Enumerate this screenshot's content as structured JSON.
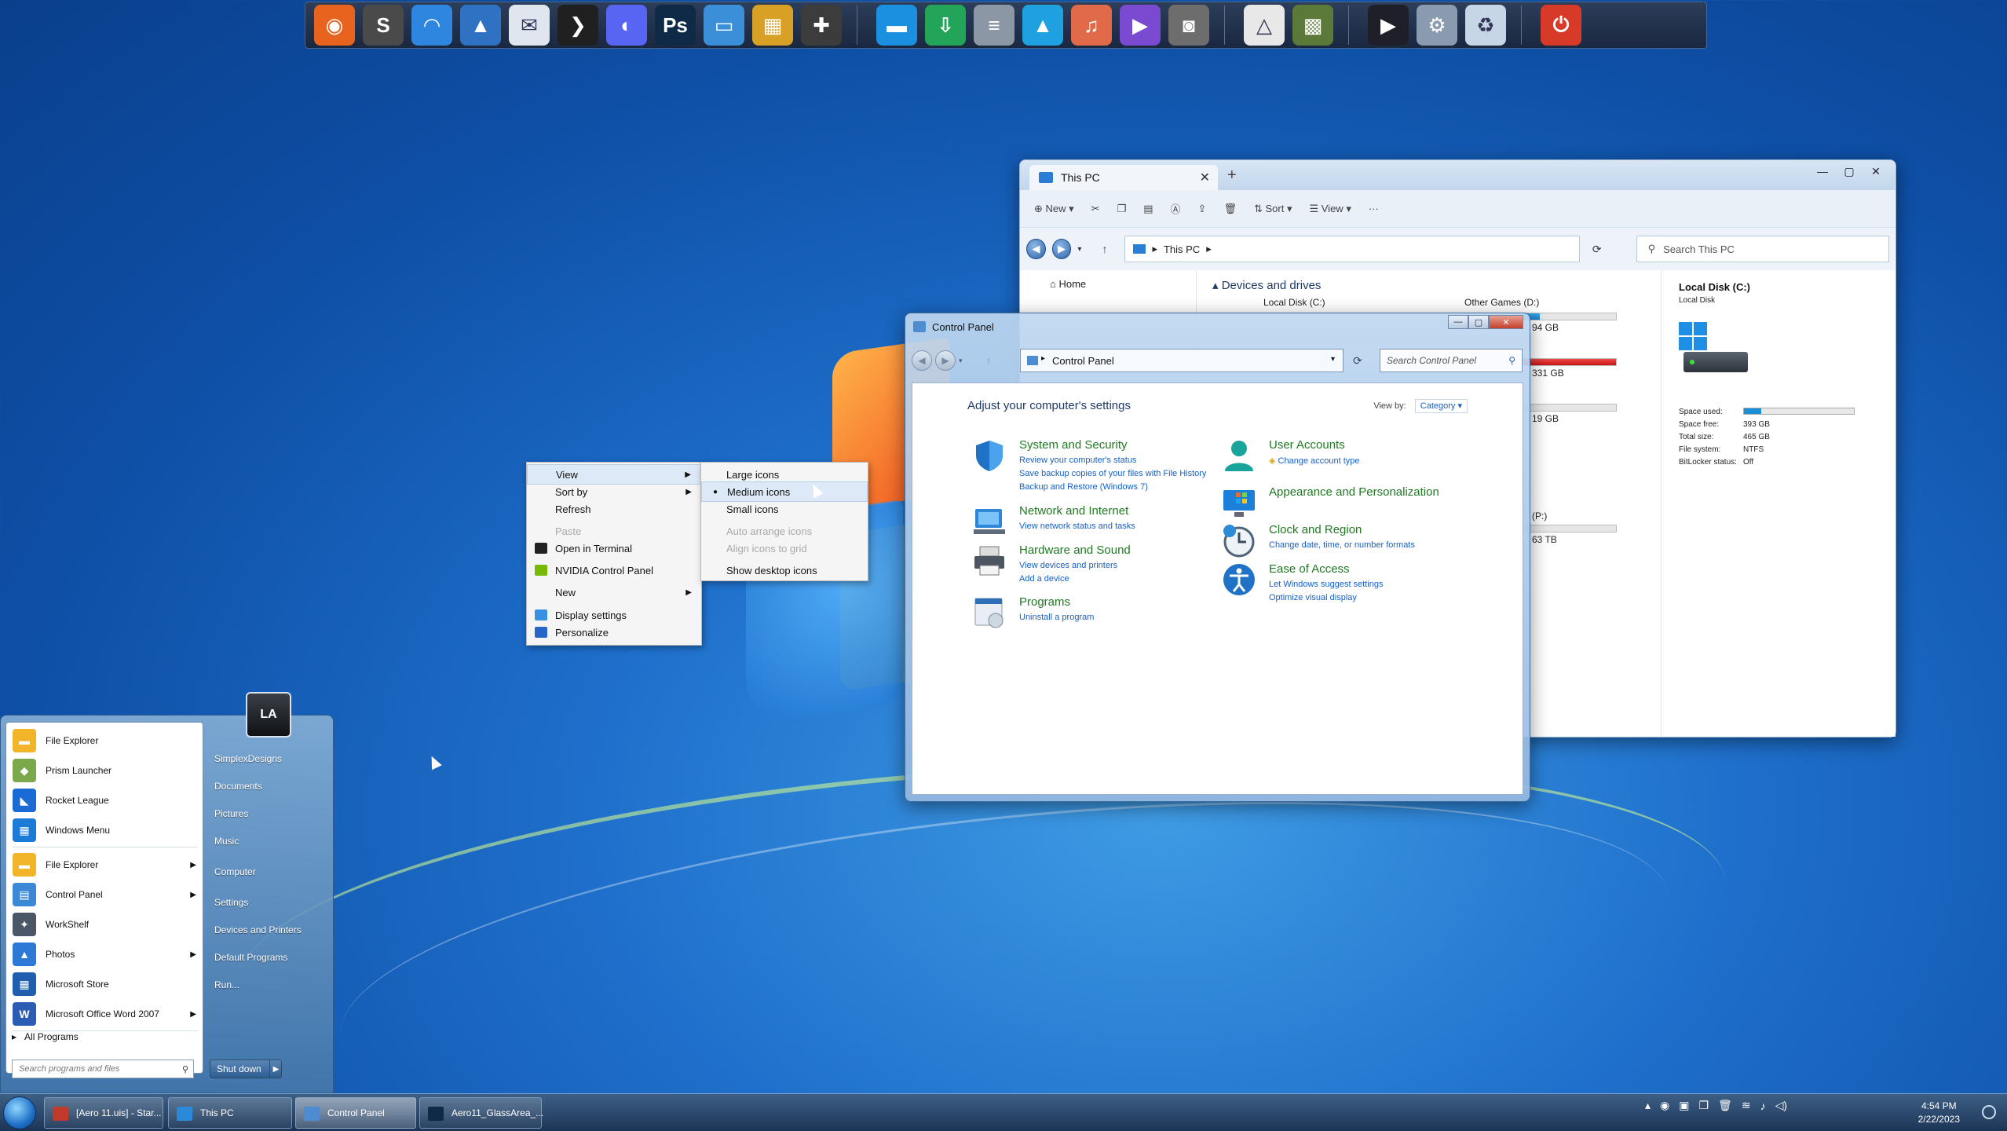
{
  "dock": {
    "items": [
      {
        "name": "firefox-icon",
        "color": "#e8631d",
        "glyph": "◉"
      },
      {
        "name": "sublime-text-icon",
        "color": "#4a4a4a",
        "glyph": "S"
      },
      {
        "name": "headphones-icon",
        "color": "#2e86de",
        "glyph": "◠"
      },
      {
        "name": "photos-icon",
        "color": "#2f72c4",
        "glyph": "▲"
      },
      {
        "name": "mail-icon",
        "color": "#e0e6ee",
        "glyph": "✉"
      },
      {
        "name": "plex-icon",
        "color": "#202020",
        "glyph": "❯"
      },
      {
        "name": "discord-icon",
        "color": "#5865f2",
        "glyph": "◐"
      },
      {
        "name": "photoshop-icon",
        "color": "#0f2a46",
        "glyph": "Ps"
      },
      {
        "name": "desktop-icon",
        "color": "#3a8fd8",
        "glyph": "▭"
      },
      {
        "name": "control-panel-icon",
        "color": "#d9a026",
        "glyph": "▦"
      },
      {
        "name": "gamepad-icon",
        "color": "#3c3c3c",
        "glyph": "✚"
      },
      {
        "name": "folder-icon",
        "color": "#1b8fe0",
        "glyph": "▬"
      },
      {
        "name": "downloads-icon",
        "color": "#22a559",
        "glyph": "⇩"
      },
      {
        "name": "documents-icon",
        "color": "#8c97a6",
        "glyph": "≡"
      },
      {
        "name": "pictures-icon",
        "color": "#1fa0e0",
        "glyph": "▲"
      },
      {
        "name": "music-icon",
        "color": "#e06a4a",
        "glyph": "♫"
      },
      {
        "name": "videos-icon",
        "color": "#7a4ad0",
        "glyph": "▶"
      },
      {
        "name": "camera-icon",
        "color": "#6d6d6d",
        "glyph": "◙"
      },
      {
        "name": "google-drive-icon",
        "color": "#e8e8e8",
        "glyph": "△"
      },
      {
        "name": "minecraft-icon",
        "color": "#5b7a3a",
        "glyph": "▩"
      },
      {
        "name": "media-player-icon",
        "color": "#1f1f2a",
        "glyph": "▶"
      },
      {
        "name": "settings-icon",
        "color": "#8a9bb0",
        "glyph": "⚙"
      },
      {
        "name": "recycle-bin-icon",
        "color": "#c6d6e6",
        "glyph": "♻"
      },
      {
        "name": "power-icon",
        "color": "#d83a2a",
        "glyph": "⏻"
      }
    ]
  },
  "this_pc": {
    "tab_title": "This PC",
    "toolbar": {
      "new": "New",
      "sort": "Sort",
      "view": "View",
      "more": "···"
    },
    "address": "This PC",
    "search_placeholder": "Search This PC",
    "nav_home": "Home",
    "section": "Devices and drives",
    "drive_c": "Local Disk (C:)",
    "drive_d": "Other Games (D:)",
    "sizes": [
      "94 GB",
      "331 GB",
      "19 GB",
      "(P:)",
      "63 TB"
    ],
    "details": {
      "title": "Local Disk (C:)",
      "subtitle": "Local Disk",
      "props": [
        {
          "k": "Space used:",
          "v": ""
        },
        {
          "k": "Space free:",
          "v": "393 GB"
        },
        {
          "k": "Total size:",
          "v": "465 GB"
        },
        {
          "k": "File system:",
          "v": "NTFS"
        },
        {
          "k": "BitLocker status:",
          "v": "Off"
        }
      ]
    }
  },
  "control_panel": {
    "title": "Control Panel",
    "address": "Control Panel",
    "search_placeholder": "Search Control Panel",
    "heading": "Adjust your computer's settings",
    "view_by_label": "View by:",
    "view_by_value": "Category",
    "categories": [
      {
        "title": "System and Security",
        "links": [
          "Review your computer's status",
          "Save backup copies of your files with File History",
          "Backup and Restore (Windows 7)"
        ]
      },
      {
        "title": "Network and Internet",
        "links": [
          "View network status and tasks"
        ]
      },
      {
        "title": "Hardware and Sound",
        "links": [
          "View devices and printers",
          "Add a device"
        ]
      },
      {
        "title": "Programs",
        "links": [
          "Uninstall a program"
        ]
      },
      {
        "title": "User Accounts",
        "links": [
          "Change account type"
        ]
      },
      {
        "title": "Appearance and Personalization",
        "links": []
      },
      {
        "title": "Clock and Region",
        "links": [
          "Change date, time, or number formats"
        ]
      },
      {
        "title": "Ease of Access",
        "links": [
          "Let Windows suggest settings",
          "Optimize visual display"
        ]
      }
    ]
  },
  "context_menu": {
    "items": [
      "View",
      "Sort by",
      "Refresh",
      "Paste",
      "Open in Terminal",
      "NVIDIA Control Panel",
      "New",
      "Display settings",
      "Personalize"
    ],
    "view_submenu": [
      "Large icons",
      "Medium icons",
      "Small icons",
      "Auto arrange icons",
      "Align icons to grid",
      "Show desktop icons"
    ]
  },
  "start_menu": {
    "pinned": [
      "File Explorer",
      "Prism Launcher",
      "Rocket League",
      "Windows Menu"
    ],
    "recent": [
      "File Explorer",
      "Control Panel",
      "WorkShelf",
      "Photos",
      "Microsoft Store",
      "Microsoft Office Word 2007"
    ],
    "all_programs": "All Programs",
    "search_placeholder": "Search programs and files",
    "right": [
      "SimplexDesigns",
      "Documents",
      "Pictures",
      "Music",
      "Computer",
      "Settings",
      "Devices and Printers",
      "Default Programs",
      "Run..."
    ],
    "shutdown": "Shut down"
  },
  "taskbar": {
    "buttons": [
      "[Aero 11.uis] - Star...",
      "This PC",
      "Control Panel",
      "Aero11_GlassArea_..."
    ],
    "time": "4:54 PM",
    "date": "2/22/2023"
  }
}
